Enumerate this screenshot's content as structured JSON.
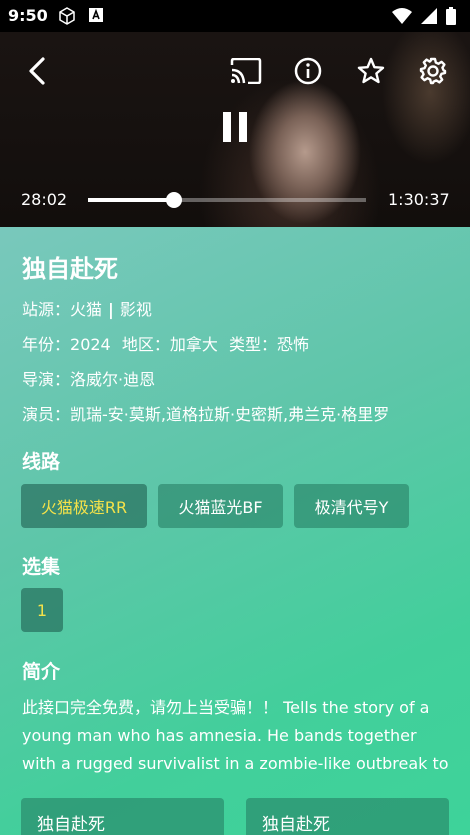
{
  "status_bar": {
    "time": "9:50"
  },
  "player": {
    "current_time": "28:02",
    "total_time": "1:30:37",
    "progress": 0.31
  },
  "info": {
    "title": "独自赴死",
    "source_label": "站源：",
    "source_name": "火猫",
    "source_separator": "|",
    "source_type": "影视",
    "year_label": "年份：",
    "year": "2024",
    "region_label": "地区：",
    "region": "加拿大",
    "genre_label": "类型：",
    "genre": "恐怖",
    "director_label": "导演：",
    "director": "洛威尔·迪恩",
    "cast_label": "演员：",
    "cast": "凯瑞-安·莫斯,道格拉斯·史密斯,弗兰克·格里罗"
  },
  "lines": {
    "title": "线路",
    "items": [
      "火猫极速RR",
      "火猫蓝光BF",
      "极清代号Y"
    ]
  },
  "episodes": {
    "title": "选集",
    "items": [
      "1"
    ]
  },
  "synopsis": {
    "title": "简介",
    "text": "此接口完全免费，请勿上当受骗！！ Tells the story of a young man who has amnesia. He bands together with a rugged survivalist in a zombie-like outbreak to"
  },
  "related": [
    "独自赴死",
    "独自赴死"
  ],
  "colors": {
    "accent": "#f4e24a",
    "panel": "#42cf9b"
  }
}
